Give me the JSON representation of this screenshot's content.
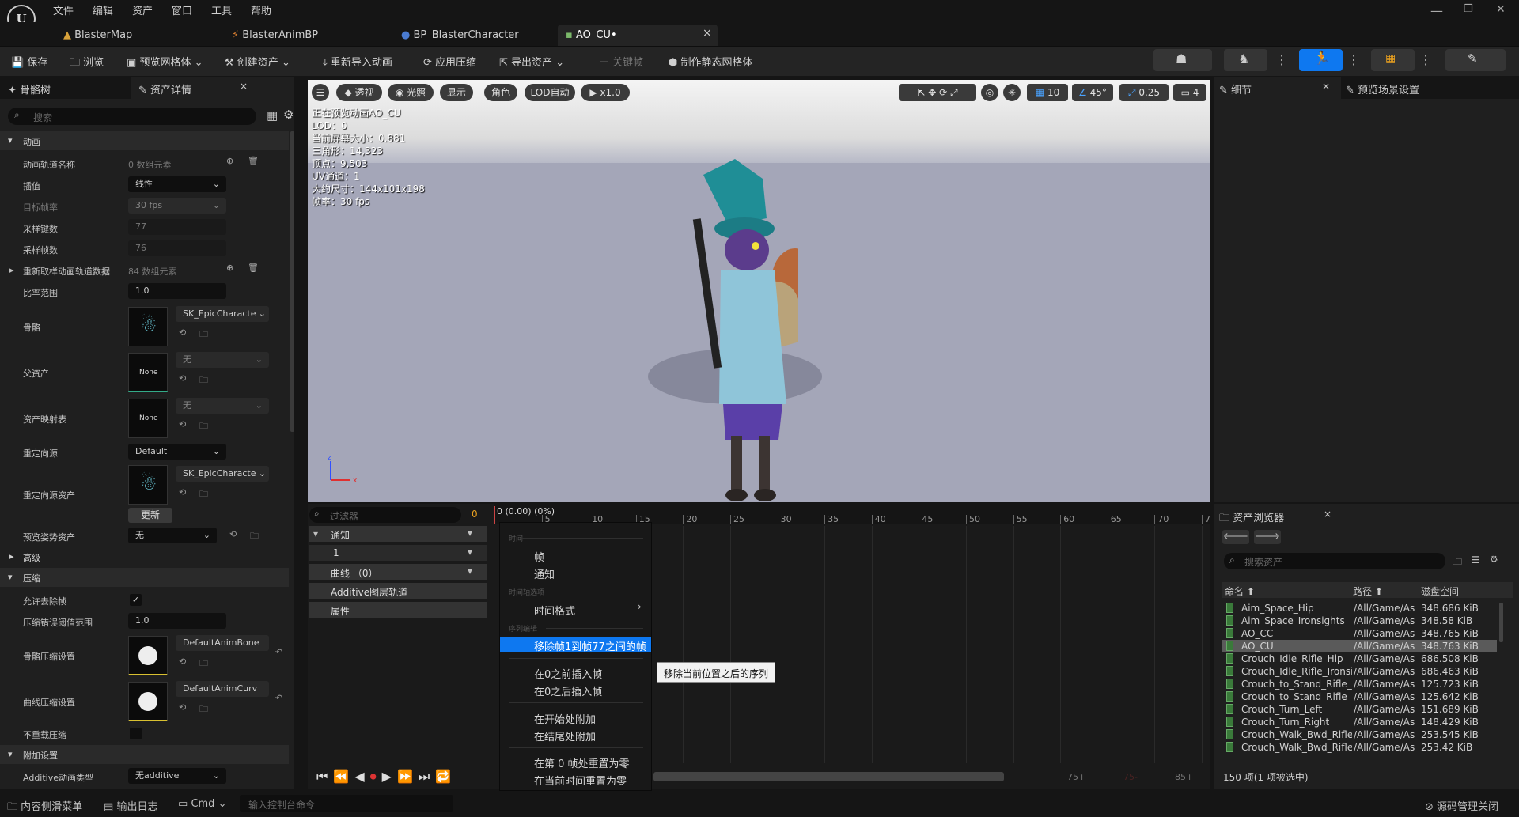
{
  "menubar": {
    "items": [
      "文件",
      "编辑",
      "资产",
      "窗口",
      "工具",
      "帮助"
    ]
  },
  "tabs": [
    {
      "label": "BlasterMap"
    },
    {
      "label": "BlasterAnimBP"
    },
    {
      "label": "BP_BlasterCharacter"
    },
    {
      "label": "AO_CU•"
    }
  ],
  "tab_close": "×",
  "window_controls": {
    "min": "—",
    "max": "❐",
    "close": "✕"
  },
  "toolbar": {
    "save": "保存",
    "browse": "浏览",
    "preview_mesh": "预览网格体",
    "create_asset": "创建资产",
    "reimport": "重新导入动画",
    "apply_compression": "应用压缩",
    "export_asset": "导出资产",
    "keyframe": "关键帧",
    "make_static_mesh": "制作静态网格体"
  },
  "left_tabs": {
    "skeleton_tree": "骨骼树",
    "asset_details": "资产详情",
    "close": "×"
  },
  "search_placeholder": "搜索",
  "details": {
    "sec_animation": "动画",
    "anim_track_names": {
      "label": "动画轨道名称",
      "value": "0 数组元素"
    },
    "interpolation": {
      "label": "插值",
      "value": "线性"
    },
    "target_frame_rate": {
      "label": "目标帧率",
      "value": "30 fps"
    },
    "sampled_keys": {
      "label": "采样键数",
      "value": "77"
    },
    "sampled_frames": {
      "label": "采样帧数",
      "value": "76"
    },
    "resampled_track_data": {
      "label": "重新取样动画轨道数据",
      "value": "84 数组元素"
    },
    "rate_scale": {
      "label": "比率范围",
      "value": "1.0"
    },
    "skeleton": {
      "label": "骨骼",
      "value": "SK_EpicCharacte"
    },
    "parent_asset": {
      "label": "父资产",
      "value": "无",
      "thumb": "None"
    },
    "asset_mapping": {
      "label": "资产映射表",
      "value": "无",
      "thumb": "None"
    },
    "retarget_source": {
      "label": "重定向源",
      "value": "Default"
    },
    "retarget_source_asset": {
      "label": "重定向源资产",
      "value": "SK_EpicCharacte",
      "update": "更新"
    },
    "preview_pose_asset": {
      "label": "预览姿势资产",
      "value": "无"
    },
    "sec_advanced": "高级",
    "sec_compression": "压缩",
    "allow_frame_stripping": {
      "label": "允许去除帧",
      "checked": true
    },
    "compression_error_threshold": {
      "label": "压缩错误阈值范围",
      "value": "1.0"
    },
    "bone_compression": {
      "label": "骨骼压缩设置",
      "value": "DefaultAnimBone"
    },
    "curve_compression": {
      "label": "曲线压缩设置",
      "value": "DefaultAnimCurv"
    },
    "no_recompress": {
      "label": "不重载压缩",
      "checked": false
    },
    "sec_additive": "附加设置",
    "additive_type": {
      "label": "Additive动画类型",
      "value": "无additive"
    }
  },
  "viewport": {
    "buttons": [
      "透视",
      "光照",
      "显示",
      "角色",
      "LOD自动",
      "x1.0"
    ],
    "grid": "10",
    "angle": "45°",
    "scale": "0.25",
    "cam": "4",
    "stats": [
      "正在预览动画AO_CU",
      "LOD：0",
      "当前屏幕大小：0.881",
      "三角形：14,323",
      "顶点：9,503",
      "UV通道：1",
      "大约尺寸：144x101x198",
      "帧率：30 fps"
    ]
  },
  "timeline": {
    "filter_placeholder": "过滤器",
    "frame_value": "0",
    "current": "0 (0.00) (0%)",
    "ticks": [
      "5",
      "10",
      "15",
      "20",
      "25",
      "30",
      "35",
      "40",
      "45",
      "50",
      "55",
      "60",
      "65",
      "70",
      "7"
    ],
    "tracks": [
      "通知",
      "1",
      "曲线 （0）",
      "Additive图层轨道",
      "属性"
    ],
    "bottom_ticks": [
      "75+",
      "75-",
      "85+"
    ]
  },
  "context_menu": {
    "h1": "时间",
    "i_frames": "帧",
    "i_notifies": "通知",
    "h2": "时间轴选项",
    "i_time_format": "时间格式",
    "h3": "序列编辑",
    "i_remove": "移除帧1到帧77之间的帧",
    "i_insert_before": "在0之前插入帧",
    "i_insert_after": "在0之后插入帧",
    "i_append_start": "在开始处附加",
    "i_append_end": "在结尾处附加",
    "i_zero_frame": "在第 0 帧处重置为零",
    "i_zero_current": "在当前时间重置为零"
  },
  "tooltip": "移除当前位置之后的序列",
  "right_tabs": {
    "details": "细节",
    "preview_settings": "预览场景设置",
    "close": "×"
  },
  "content_browser": {
    "title": "资产浏览器",
    "search_placeholder": "搜索资产",
    "cols": {
      "name": "命名",
      "path": "路径",
      "disk": "磁盘空间"
    },
    "rows": [
      {
        "name": "Aim_Space_Hip",
        "path": "/All/Game/As",
        "size": "348.686 KiB"
      },
      {
        "name": "Aim_Space_Ironsights",
        "path": "/All/Game/As",
        "size": "348.58 KiB"
      },
      {
        "name": "AO_CC",
        "path": "/All/Game/As",
        "size": "348.765 KiB"
      },
      {
        "name": "AO_CU",
        "path": "/All/Game/As",
        "size": "348.763 KiB"
      },
      {
        "name": "Crouch_Idle_Rifle_Hip",
        "path": "/All/Game/As",
        "size": "686.508 KiB"
      },
      {
        "name": "Crouch_Idle_Rifle_Ironsi",
        "path": "/All/Game/As",
        "size": "686.463 KiB"
      },
      {
        "name": "Crouch_to_Stand_Rifle_I",
        "path": "/All/Game/As",
        "size": "125.723 KiB"
      },
      {
        "name": "Crouch_to_Stand_Rifle_I",
        "path": "/All/Game/As",
        "size": "125.642 KiB"
      },
      {
        "name": "Crouch_Turn_Left",
        "path": "/All/Game/As",
        "size": "151.689 KiB"
      },
      {
        "name": "Crouch_Turn_Right",
        "path": "/All/Game/As",
        "size": "148.429 KiB"
      },
      {
        "name": "Crouch_Walk_Bwd_Rifle",
        "path": "/All/Game/As",
        "size": "253.545 KiB"
      },
      {
        "name": "Crouch_Walk_Bwd_Rifle",
        "path": "/All/Game/As",
        "size": "253.42 KiB"
      }
    ],
    "count": "150 项(1 项被选中)"
  },
  "statusbar": {
    "content_drawer": "内容侧滑菜单",
    "output_log": "输出日志",
    "cmd": "Cmd",
    "console_placeholder": "输入控制台命令",
    "source_control": "源码管理关闭"
  }
}
